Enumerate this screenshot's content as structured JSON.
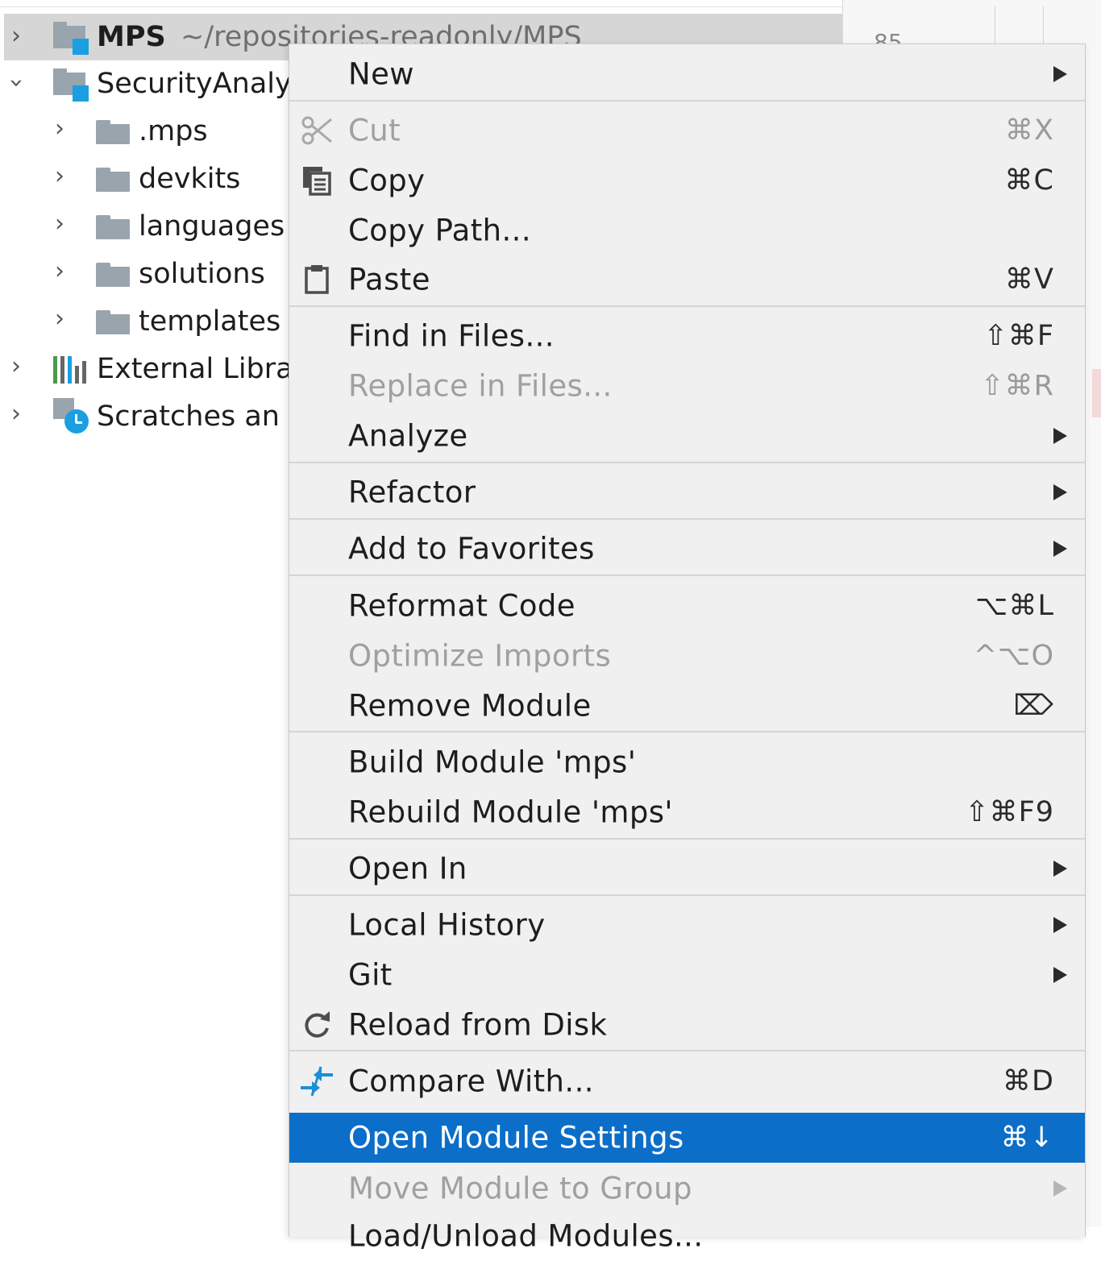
{
  "tree": {
    "root": {
      "name": "MPS",
      "path": "~/repositories-readonly/MPS"
    },
    "security": "SecurityAnaly",
    "folders": [
      ".mps",
      "devkits",
      "languages",
      "solutions",
      "templates"
    ],
    "external": "External Libra",
    "scratches": "Scratches an"
  },
  "right_panel": {
    "num": "85"
  },
  "menu": {
    "new": "New",
    "cut": {
      "label": "Cut",
      "shortcut": "⌘X"
    },
    "copy": {
      "label": "Copy",
      "shortcut": "⌘C"
    },
    "copy_path": "Copy Path...",
    "paste": {
      "label": "Paste",
      "shortcut": "⌘V"
    },
    "find_in_files": {
      "label": "Find in Files...",
      "shortcut": "⇧⌘F"
    },
    "replace_in_files": {
      "label": "Replace in Files...",
      "shortcut": "⇧⌘R"
    },
    "analyze": "Analyze",
    "refactor": "Refactor",
    "add_to_favorites": "Add to Favorites",
    "reformat_code": {
      "label": "Reformat Code",
      "shortcut": "⌥⌘L"
    },
    "optimize_imports": {
      "label": "Optimize Imports",
      "shortcut": "^⌥O"
    },
    "remove_module": {
      "label": "Remove Module",
      "shortcut": "⌦"
    },
    "build_module": "Build Module 'mps'",
    "rebuild_module": {
      "label": "Rebuild Module 'mps'",
      "shortcut": "⇧⌘F9"
    },
    "open_in": "Open In",
    "local_history": "Local History",
    "git": "Git",
    "reload_from_disk": "Reload from Disk",
    "compare_with": {
      "label": "Compare With...",
      "shortcut": "⌘D"
    },
    "open_module_settings": {
      "label": "Open Module Settings",
      "shortcut": "⌘↓"
    },
    "move_module_to_group": "Move Module to Group",
    "load_unload_modules": "Load/Unload Modules..."
  },
  "colors": {
    "highlight": "#0b6ec9",
    "module_badge": "#1a9fe0",
    "menu_bg": "#f0f0f0"
  },
  "icons": [
    "chevron-right-icon",
    "chevron-down-icon",
    "folder-icon",
    "module-icon",
    "library-icon",
    "scratch-icon",
    "scissors-icon",
    "copy-icon",
    "clipboard-icon",
    "refresh-icon",
    "compare-icon",
    "submenu-arrow-icon",
    "delete-key-icon"
  ]
}
